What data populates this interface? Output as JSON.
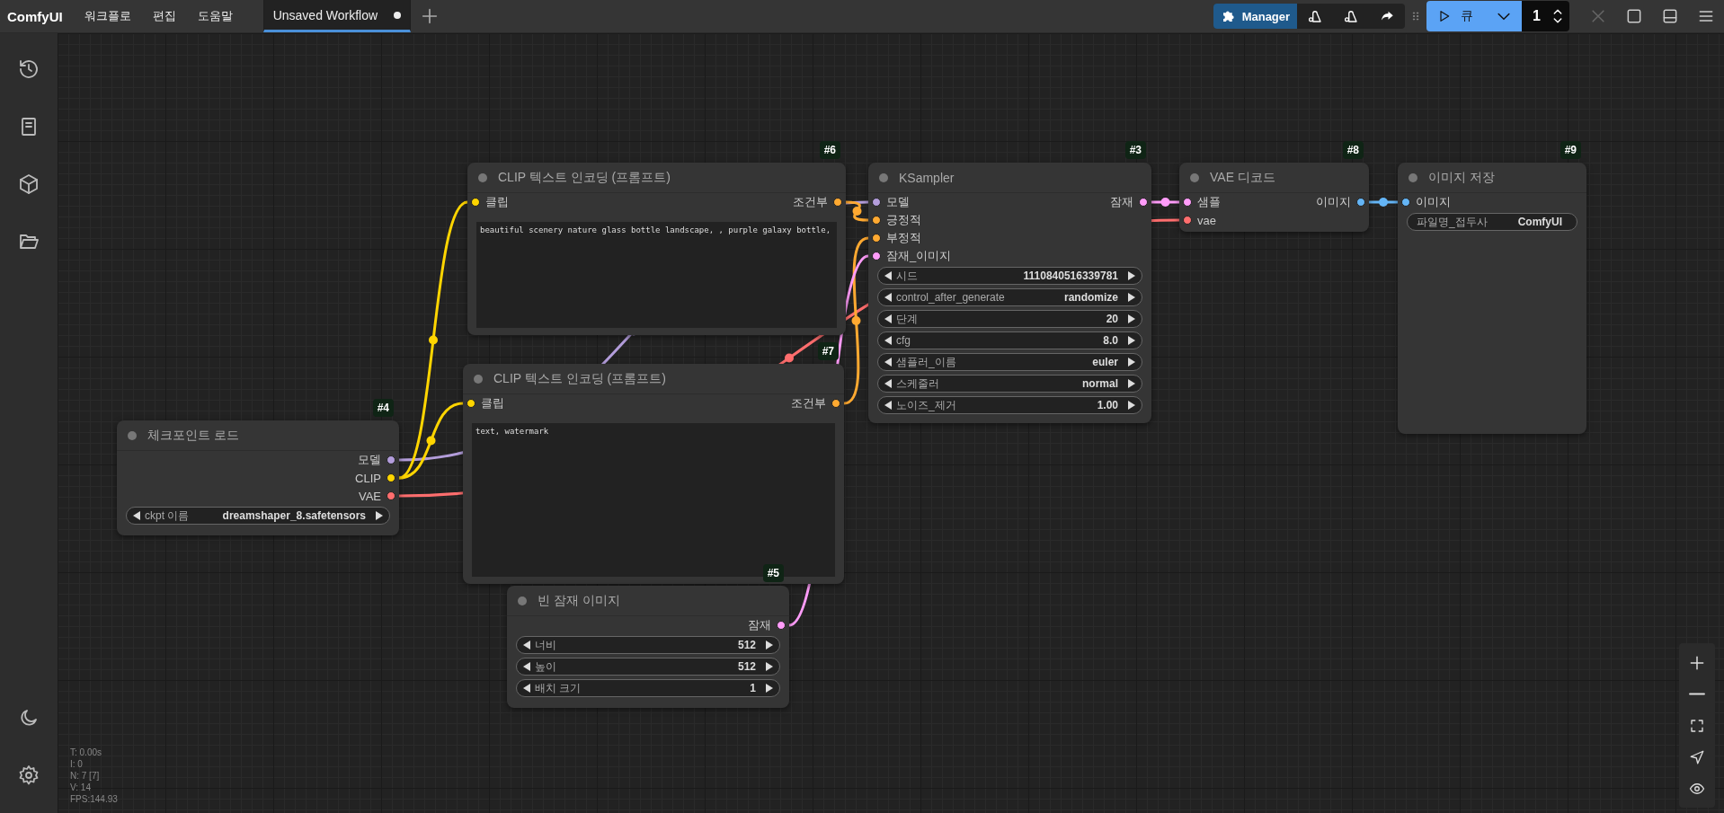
{
  "logo": "ComfyUI",
  "menu": [
    "워크플로",
    "편집",
    "도움말"
  ],
  "tabs": [
    {
      "label": "Unsaved Workflow",
      "selected": true,
      "unsaved": true
    }
  ],
  "toolbar": {
    "manager": "Manager",
    "run_label": "큐",
    "batch_count": "1",
    "interrupt_disabled": true
  },
  "nodes": [
    {
      "badge": "#6",
      "title": "CLIP 텍스트 인코딩 (프롬프트)",
      "inputs": [
        {
          "label": "클립",
          "color": "#ffd500"
        }
      ],
      "outputs": [
        {
          "label": "조건부",
          "color": "#ffa931"
        }
      ],
      "prompt": "beautiful scenery nature glass bottle landscape, , purple galaxy bottle,"
    },
    {
      "badge": "#3",
      "title": "KSampler",
      "inputs": [
        {
          "label": "모델",
          "color": "#b39ddb"
        },
        {
          "label": "긍정적",
          "color": "#ffa931"
        },
        {
          "label": "부정적",
          "color": "#ffa931"
        },
        {
          "label": "잠재_이미지",
          "color": "#ff9cf9"
        }
      ],
      "outputs": [
        {
          "label": "잠재",
          "color": "#ff9cf9"
        }
      ],
      "widgets": [
        {
          "kind": "number",
          "label": "시드",
          "value": "1110840516339781"
        },
        {
          "kind": "combo",
          "label": "control_after_generate",
          "value": "randomize"
        },
        {
          "kind": "number",
          "label": "단계",
          "value": "20"
        },
        {
          "kind": "number",
          "label": "cfg",
          "value": "8.0"
        },
        {
          "kind": "combo",
          "label": "샘플러_이름",
          "value": "euler"
        },
        {
          "kind": "combo",
          "label": "스케줄러",
          "value": "normal"
        },
        {
          "kind": "number",
          "label": "노이즈_제거",
          "value": "1.00"
        }
      ]
    },
    {
      "badge": "#8",
      "title": "VAE 디코드",
      "inputs": [
        {
          "label": "샘플",
          "color": "#ff9cf9"
        },
        {
          "label": "vae",
          "color": "#ff6e6e"
        }
      ],
      "outputs": [
        {
          "label": "이미지",
          "color": "#64b5f6"
        }
      ]
    },
    {
      "badge": "#9",
      "title": "이미지 저장",
      "inputs": [
        {
          "label": "이미지",
          "color": "#64b5f6"
        }
      ],
      "widgets": [
        {
          "kind": "text",
          "label": "파일명_접두사",
          "value": "ComfyUI"
        }
      ]
    },
    {
      "badge": "#4",
      "title": "체크포인트 로드",
      "outputs": [
        {
          "label": "모델",
          "color": "#b39ddb"
        },
        {
          "label": "CLIP",
          "color": "#ffd500"
        },
        {
          "label": "VAE",
          "color": "#ff6e6e"
        }
      ],
      "widgets": [
        {
          "kind": "combo",
          "label": "ckpt 이름",
          "value": "dreamshaper_8.safetensors"
        }
      ]
    },
    {
      "badge": "#7",
      "title": "CLIP 텍스트 인코딩 (프롬프트)",
      "inputs": [
        {
          "label": "클립",
          "color": "#ffd500"
        }
      ],
      "outputs": [
        {
          "label": "조건부",
          "color": "#ffa931"
        }
      ],
      "prompt": "text, watermark"
    },
    {
      "badge": "#5",
      "title": "빈 잠재 이미지",
      "outputs": [
        {
          "label": "잠재",
          "color": "#ff9cf9"
        }
      ],
      "widgets": [
        {
          "kind": "number",
          "label": "너비",
          "value": "512"
        },
        {
          "kind": "number",
          "label": "높이",
          "value": "512"
        },
        {
          "kind": "number",
          "label": "배치 크기",
          "value": "1"
        }
      ]
    }
  ],
  "stats": [
    "T: 0.00s",
    "I: 0",
    "N: 7 [7]",
    "V: 14",
    "FPS:144.93"
  ]
}
